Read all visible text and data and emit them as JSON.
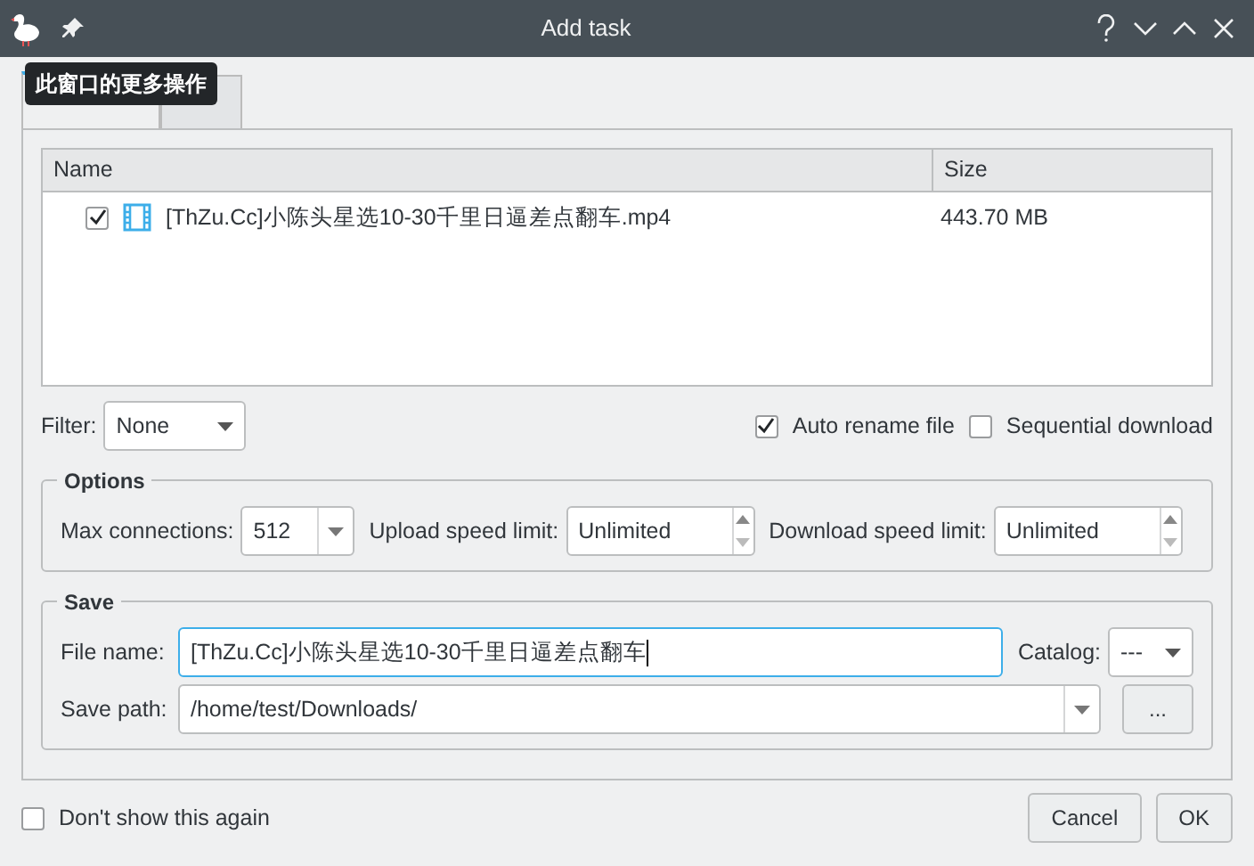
{
  "window": {
    "title": "Add task",
    "tooltip": "此窗口的更多操作"
  },
  "tabs": [
    {
      "selected": true
    },
    {
      "selected": false
    }
  ],
  "files": {
    "columns": [
      "Name",
      "Size"
    ],
    "rows": [
      {
        "checked": true,
        "name": "[ThZu.Cc]小陈头星选10-30千里日逼差点翻车.mp4",
        "size": "443.70 MB"
      }
    ]
  },
  "filter": {
    "label": "Filter:",
    "value": "None"
  },
  "checks": [
    {
      "label": "Auto rename file",
      "checked": true
    },
    {
      "label": "Sequential download",
      "checked": false
    }
  ],
  "options": {
    "title": "Options",
    "max_connections": {
      "label": "Max connections:",
      "value": "512"
    },
    "upload": {
      "label": "Upload speed limit:",
      "value": "Unlimited"
    },
    "download": {
      "label": "Download speed limit:",
      "value": "Unlimited"
    }
  },
  "save": {
    "title": "Save",
    "file_name": {
      "label": "File name:",
      "value": "[ThZu.Cc]小陈头星选10-30千里日逼差点翻车"
    },
    "catalog": {
      "label": "Catalog:",
      "value": "---"
    },
    "save_path": {
      "label": "Save path:",
      "value": "/home/test/Downloads/"
    },
    "browse": "..."
  },
  "dont_show": {
    "label": "Don't show this again",
    "checked": false
  },
  "buttons": [
    "Cancel",
    "OK"
  ]
}
